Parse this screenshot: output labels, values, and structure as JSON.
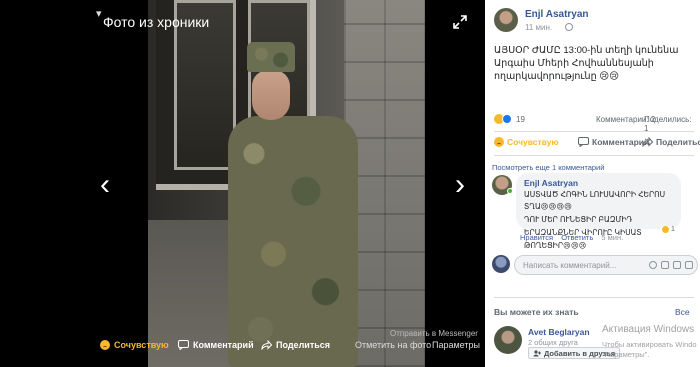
{
  "viewer": {
    "title": "Фото из хроники",
    "send_messenger": "Отправить в Messenger",
    "bottom_bar": {
      "sympathy": "Сочувствую",
      "comment": "Комментарий",
      "share": "Поделиться",
      "tag_photo": "Отметить на фото",
      "params": "Параметры"
    },
    "nav_prev": "‹",
    "nav_next": "›"
  },
  "post": {
    "author": "Enjl Asatryan",
    "time": "11 мин.",
    "text": "ԱՅՍՕՐ ԺԱՄԸ 13:00-ին տեղի կունենա Արգաիս Մհերի Հովհաննեսյանի ողարկավորությունը 😢😢",
    "reactions_count": "19",
    "comments_count": "Комментарии: 2",
    "shares_count": "Поделились: 1",
    "actions": {
      "sympathy": "Сочувствую",
      "comment": "Комментарий",
      "share": "Поделиться"
    }
  },
  "comments": {
    "more_link": "Посмотреть еще 1 комментарий",
    "items": [
      {
        "author": "Enjl Asatryan",
        "line1": "ԱՍՏՎԱԾ ՀՈԳԻՆ ԼՈՒՍԱՎՈՐԻ ՀԵՐՈՍ ՏՂԱ😢😢😢😢",
        "line2": "ԴՈՒ ՄԵՐ ՈՒՆԵՑԻՐ ԲԱԶՄԻԴ",
        "line3": "ԵՐԱԶԱՆՔՆԵՐ ՎԻՐՈՒԸ ԿԻՍԱՏ",
        "line4": "ԹՈՂԵՑԻՐ😢😢😢",
        "reaction_count": "1",
        "like": "Нравится",
        "reply": "Ответить",
        "time": "5 мин."
      }
    ],
    "compose_placeholder": "Написать комментарий..."
  },
  "people_you_may_know": {
    "header": "Вы можете их знать",
    "see_all": "Все",
    "person": {
      "name": "Avet Beglaryan",
      "mutual": "2 общих друга",
      "add_button": "Добавить в друзья"
    }
  },
  "windows_watermark": {
    "title": "Активация Windows",
    "sub_line1": "Чтобы активировать Windo",
    "sub_line2": "\"Параметры\"."
  },
  "colors": {
    "link_blue": "#385898",
    "sympathy_yellow": "#f7b928",
    "muted_gray": "#90949c",
    "panel_bg": "#ffffff",
    "stage_bg": "#000000"
  }
}
